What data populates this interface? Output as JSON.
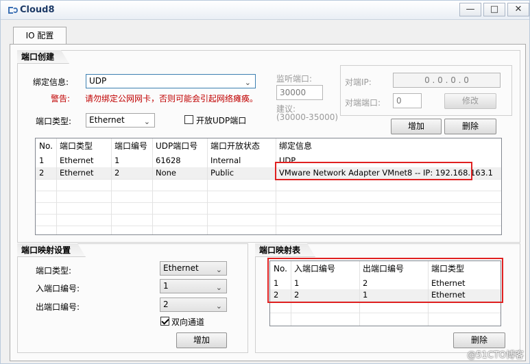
{
  "window": {
    "title": "Cloud8",
    "tab": "IO 配置"
  },
  "port_create": {
    "title": "端口创建",
    "bind_label": "绑定信息:",
    "bind_value": "UDP",
    "warning_label": "警告:",
    "warning_text": "请勿绑定公网网卡，否则可能会引起网络瘫痪。",
    "port_type_label": "端口类型:",
    "port_type_value": "Ethernet",
    "open_udp_label": "开放UDP端口",
    "listen_label": "监听端口:",
    "listen_value": "30000",
    "suggest_label": "建议:",
    "suggest_range": "(30000-35000)",
    "peer_ip_label": "对端IP:",
    "peer_ip_value": "0 . 0 . 0 . 0",
    "peer_port_label": "对端端口:",
    "peer_port_value": "0",
    "modify_button": "修改",
    "add_button": "增加",
    "delete_button": "删除",
    "table": {
      "headers": [
        "No.",
        "端口类型",
        "端口编号",
        "UDP端口号",
        "端口开放状态",
        "绑定信息"
      ],
      "rows": [
        [
          "1",
          "Ethernet",
          "1",
          "61628",
          "Internal",
          "UDP"
        ],
        [
          "2",
          "Ethernet",
          "2",
          "None",
          "Public",
          "VMware Network Adapter VMnet8 -- IP: 192.168.163.1"
        ]
      ]
    }
  },
  "port_map_settings": {
    "title": "端口映射设置",
    "port_type_label": "端口类型:",
    "port_type_value": "Ethernet",
    "in_port_label": "入端口编号:",
    "in_port_value": "1",
    "out_port_label": "出端口编号:",
    "out_port_value": "2",
    "bidirectional_label": "双向通道",
    "add_button": "增加"
  },
  "port_map_table": {
    "title": "端口映射表",
    "headers": [
      "No.",
      "入端口编号",
      "出端口编号",
      "端口类型"
    ],
    "rows": [
      [
        "1",
        "1",
        "2",
        "Ethernet"
      ],
      [
        "2",
        "2",
        "1",
        "Ethernet"
      ]
    ],
    "delete_button": "删除"
  },
  "watermark": "@51CTO博客",
  "colors": {
    "warning": "#c00000",
    "highlight_box": "#e02020",
    "title_text": "#1d3a66"
  }
}
